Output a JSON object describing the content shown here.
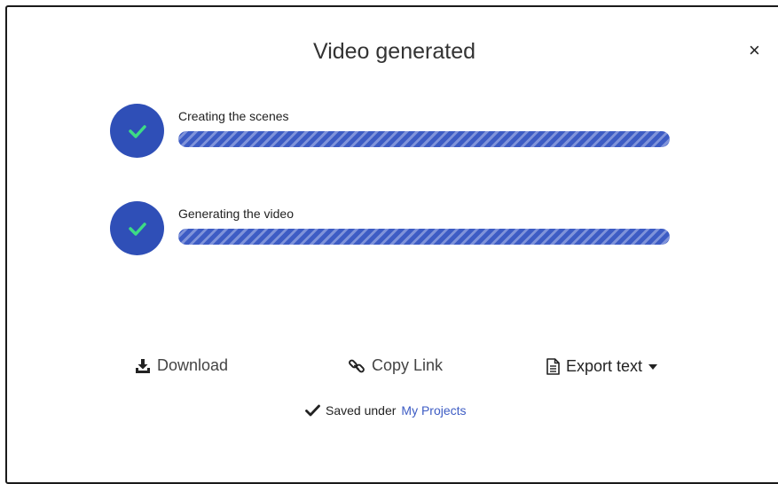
{
  "dialog": {
    "title": "Video generated",
    "close_label": "×"
  },
  "steps": [
    {
      "label": "Creating the scenes",
      "status": "complete",
      "progress": 1.0
    },
    {
      "label": "Generating the video",
      "status": "complete",
      "progress": 1.0
    }
  ],
  "actions": {
    "download_label": "Download",
    "copy_link_label": "Copy Link",
    "export_text_label": "Export text"
  },
  "saved": {
    "text": "Saved under",
    "link_text": "My Projects"
  },
  "colors": {
    "accent": "#2f4fb7",
    "check": "#3ddc84",
    "link": "#3d5cc4"
  },
  "icons": [
    "check-icon",
    "download-icon",
    "link-icon",
    "document-icon",
    "caret-down-icon",
    "checkmark-icon",
    "close-icon"
  ]
}
